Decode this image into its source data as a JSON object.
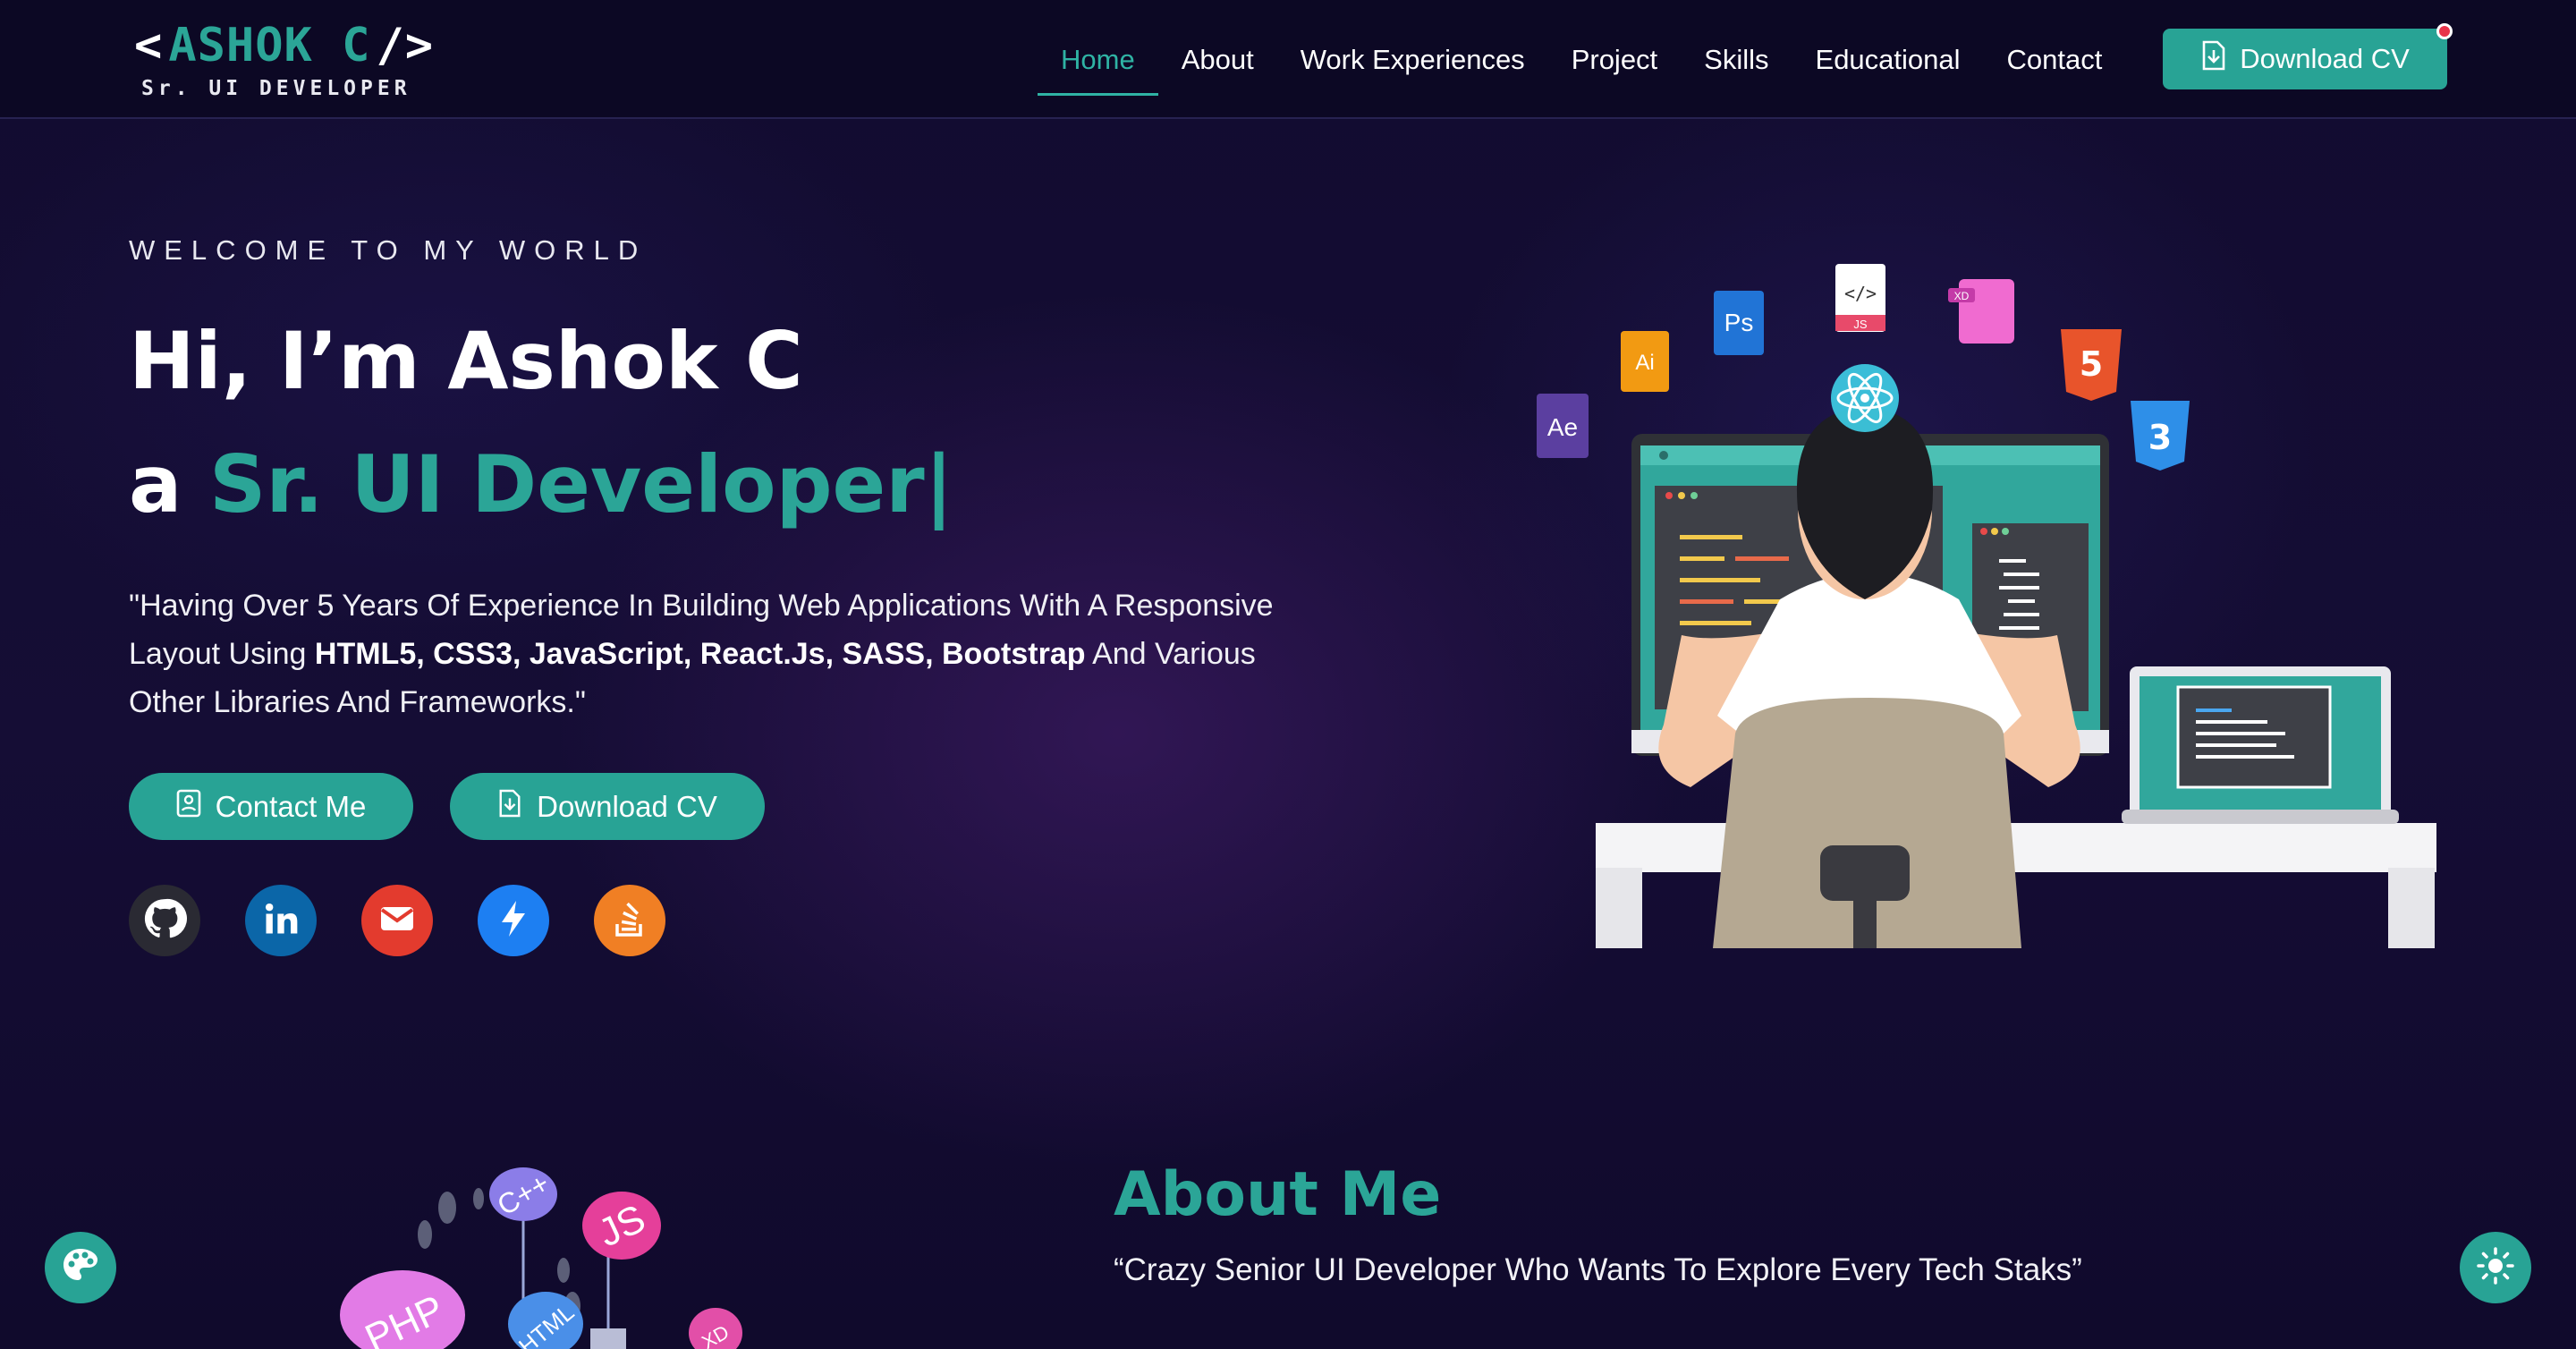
{
  "logo": {
    "open": "<",
    "name": "ASHOK C",
    "close": "/>",
    "subtitle": "Sr. UI DEVELOPER"
  },
  "nav": {
    "items": [
      {
        "label": "Home",
        "active": true
      },
      {
        "label": "About",
        "active": false
      },
      {
        "label": "Work Experiences",
        "active": false
      },
      {
        "label": "Project",
        "active": false
      },
      {
        "label": "Skills",
        "active": false
      },
      {
        "label": "Educational",
        "active": false
      },
      {
        "label": "Contact",
        "active": false
      }
    ],
    "cv_label": "Download CV"
  },
  "hero": {
    "welcome": "WELCOME TO MY WORLD",
    "greeting": "Hi, I’m Ashok C",
    "role_prefix": "a ",
    "role": "Sr. UI Developer",
    "cursor": "|",
    "description_1": "\"Having Over 5 Years Of Experience In Building Web Applications With A Responsive Layout Using ",
    "description_tech": "HTML5, CSS3, JavaScript, React.Js, SASS, Bootstrap",
    "description_2": " And Various Other Libraries And Frameworks.\"",
    "contact_label": "Contact Me",
    "cv_label": "Download CV"
  },
  "socials": [
    {
      "icon": "github-icon",
      "color": "#2a2a33"
    },
    {
      "icon": "linkedin-icon",
      "color": "#0b66a8"
    },
    {
      "icon": "gmail-icon",
      "color": "#e33b2e"
    },
    {
      "icon": "flash-icon",
      "color": "#1d7ff2"
    },
    {
      "icon": "stackoverflow-icon",
      "color": "#f07f24"
    }
  ],
  "illustration": {
    "tool_badges": [
      "Ae",
      "Ai",
      "Ps",
      "JS",
      "XD"
    ]
  },
  "about": {
    "title": "About Me",
    "quote": "“Crazy Senior UI Developer Who Wants To Explore Every Tech Staks”"
  },
  "tech_stack_badges": [
    "PHP",
    "C++",
    "JS",
    "HTML",
    "XD"
  ],
  "colors": {
    "accent": "#28a395",
    "background": "#120c30",
    "nav_border": "#272251",
    "notification": "#e8334a"
  }
}
